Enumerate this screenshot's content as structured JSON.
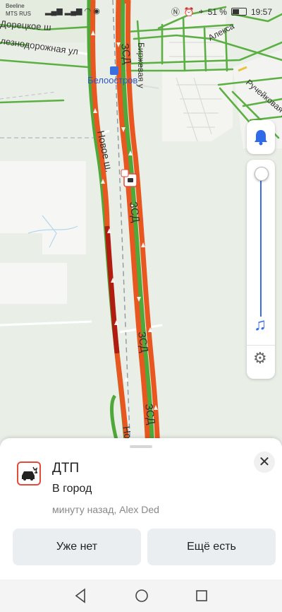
{
  "status_bar": {
    "carrier1": "Beeline",
    "carrier2": "MTS RUS",
    "battery": "51 %",
    "time": "19:57"
  },
  "map": {
    "labels": {
      "road_top_left": "Дорецкое ш",
      "rail_road": "лезнодорожная ул",
      "station": "Белоостров",
      "birzhevaya": "Биржевая у",
      "aleksa": "Алекса",
      "rucheinaya": "Ручейковая у",
      "novoe": "Новое ш.",
      "novoe_bottom": "Но",
      "zsd": "ЗСД"
    },
    "bell_icon": "bell-icon",
    "music_icon": "music-note-icon",
    "settings_icon": "gear-icon",
    "volume_level": 1.0
  },
  "sheet": {
    "title": "ДТП",
    "direction": "В город",
    "meta": "минуту назад, Alex Ded",
    "btn_gone": "Уже нет",
    "btn_still": "Ещё есть"
  },
  "colors": {
    "traffic_heavy": "#e8571f",
    "traffic_jam": "#b01d10",
    "traffic_free": "#4fa83a",
    "accent": "#2f6be8"
  }
}
